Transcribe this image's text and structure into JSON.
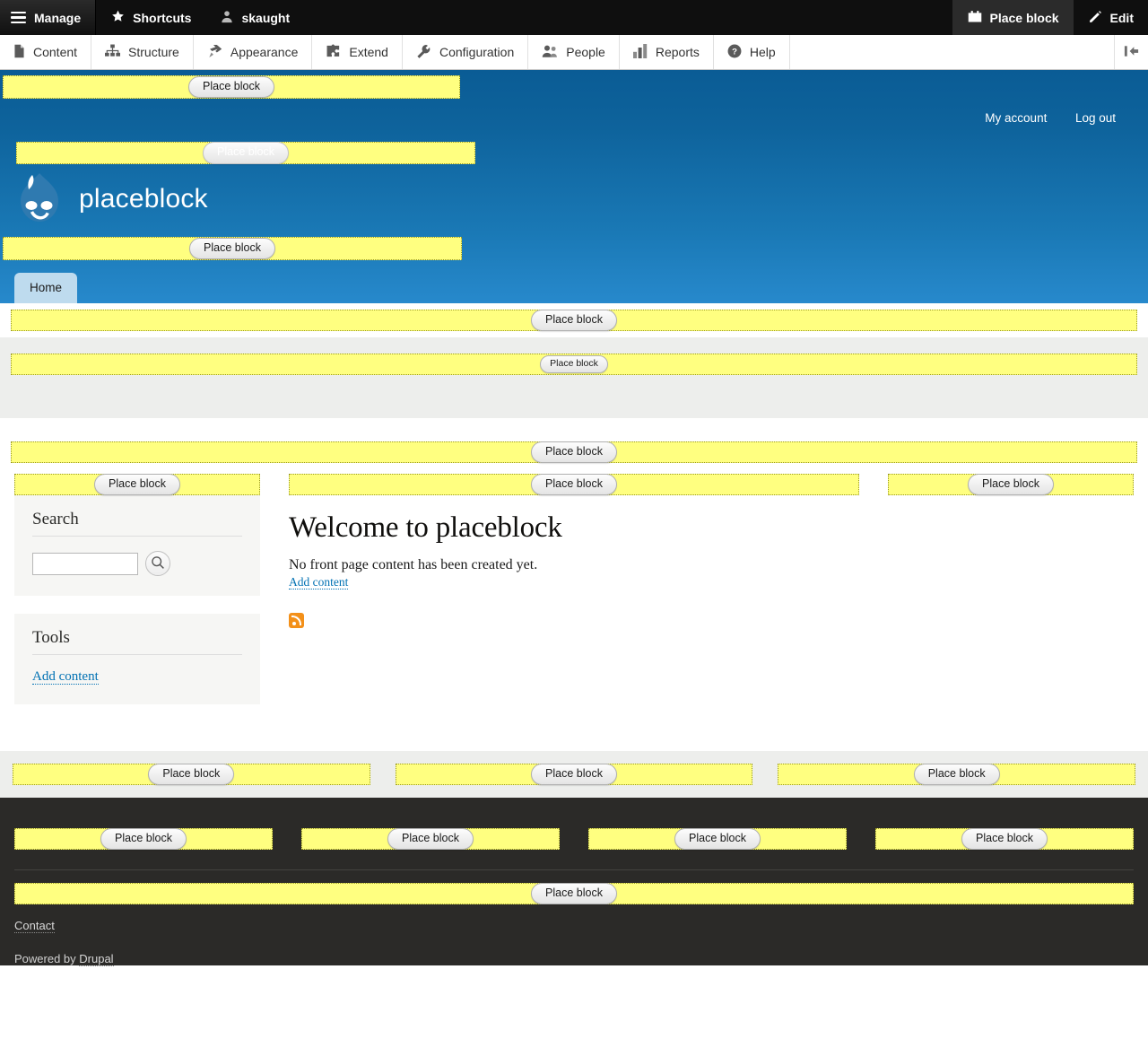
{
  "toolbar": {
    "home_label": "Manage",
    "home_icon": "hamburger-icon",
    "tabs": [
      {
        "label": "Shortcuts",
        "icon": "star-icon"
      },
      {
        "label": "skaught",
        "icon": "person-icon"
      }
    ],
    "right_tabs": [
      {
        "label": "Place block",
        "icon": "block-icon",
        "active": true
      },
      {
        "label": "Edit",
        "icon": "pencil-icon",
        "active": false
      }
    ],
    "collapse_icon": "collapse-toolbar-icon"
  },
  "admin_menu": {
    "items": [
      {
        "label": "Content",
        "icon": "file-icon"
      },
      {
        "label": "Structure",
        "icon": "structure-icon"
      },
      {
        "label": "Appearance",
        "icon": "paintbrush-icon"
      },
      {
        "label": "Extend",
        "icon": "puzzle-icon"
      },
      {
        "label": "Configuration",
        "icon": "wrench-icon"
      },
      {
        "label": "People",
        "icon": "people-icon"
      },
      {
        "label": "Reports",
        "icon": "bar-chart-icon"
      },
      {
        "label": "Help",
        "icon": "question-icon"
      }
    ]
  },
  "banner": {
    "account_links": [
      {
        "label": "My account"
      },
      {
        "label": "Log out"
      }
    ],
    "site_name": "placeblock",
    "logo_icon": "drupal-droplet-logo"
  },
  "tabs": {
    "home_label": "Home"
  },
  "place_block": {
    "label": "Place block"
  },
  "sidebar_first": {
    "search": {
      "title": "Search",
      "input_value": "",
      "input_placeholder": "",
      "button_icon": "search-icon"
    },
    "tools": {
      "title": "Tools",
      "links": [
        {
          "label": "Add content"
        }
      ]
    }
  },
  "main": {
    "title": "Welcome to placeblock",
    "body": "No front page content has been created yet.",
    "add_content_label": "Add content",
    "feed_icon": "rss-feed-icon"
  },
  "footer": {
    "contact_label": "Contact",
    "powered_prefix": "Powered by ",
    "powered_link": "Drupal"
  },
  "colors": {
    "placeholder_yellow": "#ffff80",
    "banner_blue_top": "#0e639c",
    "banner_blue_bottom": "#2789cc",
    "footer_dark": "#2b2a28",
    "link_blue": "#0071b3",
    "rss_orange": "#f39019"
  }
}
